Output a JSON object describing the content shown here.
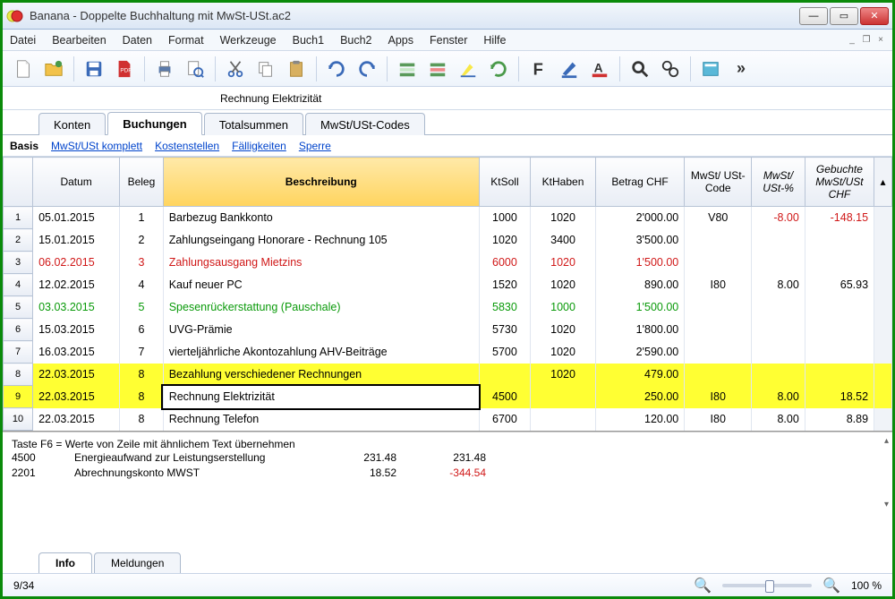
{
  "window": {
    "title": "Banana - Doppelte Buchhaltung mit MwSt-USt.ac2"
  },
  "menu": [
    "Datei",
    "Bearbeiten",
    "Daten",
    "Format",
    "Werkzeuge",
    "Buch1",
    "Buch2",
    "Apps",
    "Fenster",
    "Hilfe"
  ],
  "formula_value": "Rechnung Elektrizität",
  "tabs": [
    "Konten",
    "Buchungen",
    "Totalsummen",
    "MwSt/USt-Codes"
  ],
  "active_tab": "Buchungen",
  "filters": {
    "basis": "Basis",
    "links": [
      "MwSt/USt komplett",
      "Kostenstellen",
      "Fälligkeiten",
      "Sperre"
    ]
  },
  "columns": {
    "datum": "Datum",
    "beleg": "Beleg",
    "beschreibung": "Beschreibung",
    "ktsoll": "KtSoll",
    "kthaben": "KtHaben",
    "betrag": "Betrag CHF",
    "ustcode": "MwSt/\nUSt-Code",
    "ustpct": "MwSt/\nUSt-%",
    "gebucht": "Gebuchte\nMwSt/USt\nCHF"
  },
  "rows": [
    {
      "n": "1",
      "datum": "05.01.2015",
      "beleg": "1",
      "desc": "Barbezug Bankkonto",
      "soll": "1000",
      "haben": "1020",
      "betrag": "2'000.00",
      "code": "V80",
      "pct": "-8.00",
      "geb": "-148.15",
      "cls": ""
    },
    {
      "n": "2",
      "datum": "15.01.2015",
      "beleg": "2",
      "desc": "Zahlungseingang Honorare - Rechnung 105",
      "soll": "1020",
      "haben": "3400",
      "betrag": "3'500.00",
      "code": "",
      "pct": "",
      "geb": "",
      "cls": ""
    },
    {
      "n": "3",
      "datum": "06.02.2015",
      "beleg": "3",
      "desc": "Zahlungsausgang Mietzins",
      "soll": "6000",
      "haben": "1020",
      "betrag": "1'500.00",
      "code": "",
      "pct": "",
      "geb": "",
      "cls": "red"
    },
    {
      "n": "4",
      "datum": "12.02.2015",
      "beleg": "4",
      "desc": "Kauf neuer PC",
      "soll": "1520",
      "haben": "1020",
      "betrag": "890.00",
      "code": "I80",
      "pct": "8.00",
      "geb": "65.93",
      "cls": ""
    },
    {
      "n": "5",
      "datum": "03.03.2015",
      "beleg": "5",
      "desc": "Spesenrückerstattung (Pauschale)",
      "soll": "5830",
      "haben": "1000",
      "betrag": "1'500.00",
      "code": "",
      "pct": "",
      "geb": "",
      "cls": "green"
    },
    {
      "n": "6",
      "datum": "15.03.2015",
      "beleg": "6",
      "desc": "UVG-Prämie",
      "soll": "5730",
      "haben": "1020",
      "betrag": "1'800.00",
      "code": "",
      "pct": "",
      "geb": "",
      "cls": ""
    },
    {
      "n": "7",
      "datum": "16.03.2015",
      "beleg": "7",
      "desc": "vierteljährliche Akontozahlung AHV-Beiträge",
      "soll": "5700",
      "haben": "1020",
      "betrag": "2'590.00",
      "code": "",
      "pct": "",
      "geb": "",
      "cls": ""
    },
    {
      "n": "8",
      "datum": "22.03.2015",
      "beleg": "8",
      "desc": "Bezahlung verschiedener Rechnungen",
      "soll": "",
      "haben": "1020",
      "betrag": "479.00",
      "code": "",
      "pct": "",
      "geb": "",
      "cls": "yellow"
    },
    {
      "n": "9",
      "datum": "22.03.2015",
      "beleg": "8",
      "desc": "Rechnung Elektrizität",
      "soll": "4500",
      "haben": "",
      "betrag": "250.00",
      "code": "I80",
      "pct": "8.00",
      "geb": "18.52",
      "cls": "selected",
      "editing": true
    },
    {
      "n": "10",
      "datum": "22.03.2015",
      "beleg": "8",
      "desc": "Rechnung Telefon",
      "soll": "6700",
      "haben": "",
      "betrag": "120.00",
      "code": "I80",
      "pct": "8.00",
      "geb": "8.89",
      "cls": ""
    }
  ],
  "info": {
    "hint": "Taste F6 = Werte von Zeile mit ähnlichem Text übernehmen",
    "lines": [
      {
        "acct": "4500",
        "name": "Energieaufwand zur Leistungserstellung",
        "v1": "231.48",
        "v2": "231.48",
        "neg": false
      },
      {
        "acct": "2201",
        "name": "Abrechnungskonto MWST",
        "v1": "18.52",
        "v2": "-344.54",
        "neg": true
      }
    ],
    "tabs": [
      "Info",
      "Meldungen"
    ],
    "active": "Info"
  },
  "status": {
    "position": "9/34",
    "zoom": "100 %"
  }
}
